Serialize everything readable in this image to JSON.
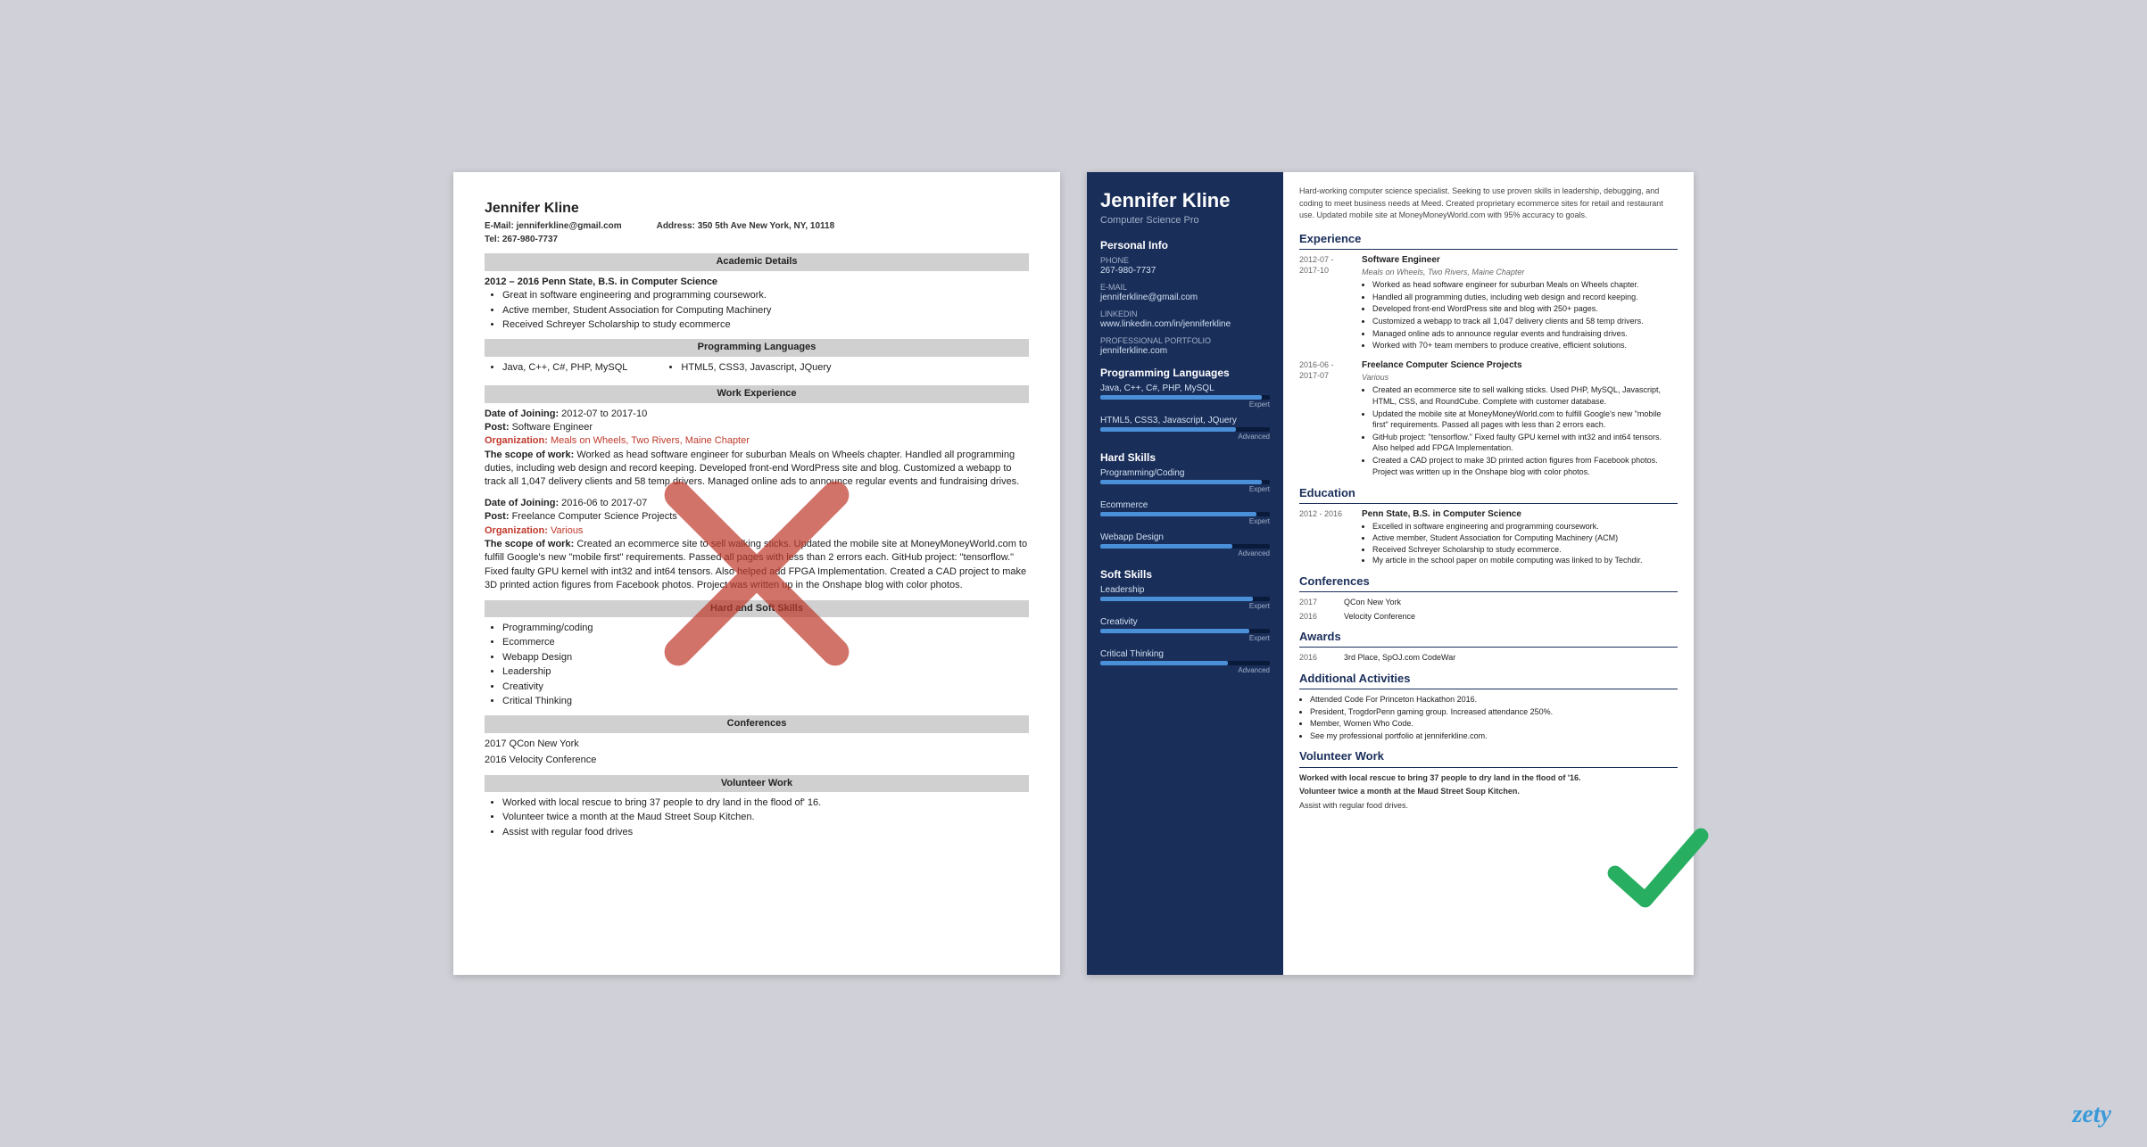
{
  "left_resume": {
    "name": "Jennifer Kline",
    "email_label": "E-Mail:",
    "email": "jenniferkline@gmail.com",
    "address_label": "Address:",
    "address": "350 5th Ave New York, NY, 10118",
    "tel_label": "Tel:",
    "tel": "267-980-7737",
    "sections": {
      "academic": {
        "title": "Academic Details",
        "edu": "2012 – 2016 Penn State, B.S. in Computer Science",
        "bullets": [
          "Great in software engineering and programming coursework.",
          "Active member, Student Association for Computing Machinery",
          "Received Schreyer Scholarship to study ecommerce"
        ]
      },
      "programming": {
        "title": "Programming Languages",
        "col1": "Java, C++, C#, PHP, MySQL",
        "col2": "HTML5, CSS3, Javascript, JQuery"
      },
      "work": {
        "title": "Work Experience",
        "jobs": [
          {
            "date_of_joining_label": "Date of Joining:",
            "date_of_joining": "2012-07 to 2017-10",
            "post_label": "Post:",
            "post": "Software Engineer",
            "org_label": "Organization:",
            "org": "Meals on Wheels, Two Rivers, Maine Chapter",
            "scope_label": "The scope of work:",
            "scope": "Worked as head software engineer for suburban Meals on Wheels chapter. Handled all programming duties, including web design and record keeping. Developed front-end WordPress site and blog. Customized a webapp to track all 1,047 delivery clients and 58 temp drivers. Managed online ads to announce regular events and fundraising drives."
          },
          {
            "date_of_joining_label": "Date of Joining:",
            "date_of_joining": "2016-06 to 2017-07",
            "post_label": "Post:",
            "post": "Freelance Computer Science Projects",
            "org_label": "Organization:",
            "org": "Various",
            "scope_label": "The scope of work:",
            "scope": "Created an ecommerce site to sell walking sticks. Updated the mobile site at MoneyMoneyWorld.com to fulfill Google's new \"mobile first\" requirements. Passed all pages with less than 2 errors each. GitHub project: \"tensorflow.\" Fixed faulty GPU kernel with int32 and int64 tensors. Also helped add FPGA Implementation. Created a CAD project to make 3D printed action figures from Facebook photos. Project was written up in the Onshape blog with color photos."
          }
        ]
      },
      "skills": {
        "title": "Hard and Soft Skills",
        "items": [
          "Programming/coding",
          "Ecommerce",
          "Webapp Design",
          "Leadership",
          "Creativity",
          "Critical Thinking"
        ]
      },
      "conferences": {
        "title": "Conferences",
        "items": [
          "2017 QCon New York",
          "2016 Velocity Conference"
        ]
      },
      "volunteer": {
        "title": "Volunteer Work",
        "bullets": [
          "Worked with local rescue to bring 37 people to dry land in the flood of' 16.",
          "Volunteer twice a month at the Maud Street Soup Kitchen.",
          "Assist with regular food drives"
        ]
      }
    }
  },
  "right_resume": {
    "sidebar": {
      "name": "Jennifer Kline",
      "title": "Computer Science Pro",
      "sections": {
        "personal_info": {
          "title": "Personal Info",
          "phone_label": "Phone",
          "phone": "267-980-7737",
          "email_label": "E-mail",
          "email": "jenniferkline@gmail.com",
          "linkedin_label": "LinkedIn",
          "linkedin": "www.linkedin.com/in/jenniferkline",
          "portfolio_label": "Professional Portfolio",
          "portfolio": "jenniferkline.com"
        },
        "programming": {
          "title": "Programming Languages",
          "skills": [
            {
              "name": "Java, C++, C#, PHP, MySQL",
              "level": "Expert",
              "pct": 95
            },
            {
              "name": "HTML5, CSS3, Javascript, JQuery",
              "level": "Advanced",
              "pct": 80
            }
          ]
        },
        "hard_skills": {
          "title": "Hard Skills",
          "skills": [
            {
              "name": "Programming/Coding",
              "level": "Expert",
              "pct": 95
            },
            {
              "name": "Ecommerce",
              "level": "Expert",
              "pct": 92
            },
            {
              "name": "Webapp Design",
              "level": "Advanced",
              "pct": 78
            }
          ]
        },
        "soft_skills": {
          "title": "Soft Skills",
          "skills": [
            {
              "name": "Leadership",
              "level": "Expert",
              "pct": 90
            },
            {
              "name": "Creativity",
              "level": "Expert",
              "pct": 88
            },
            {
              "name": "Critical Thinking",
              "level": "Advanced",
              "pct": 75
            }
          ]
        }
      }
    },
    "main": {
      "summary": "Hard-working computer science specialist. Seeking to use proven skills in leadership, debugging, and coding to meet business needs at Meed. Created proprietary ecommerce sites for retail and restaurant use. Updated mobile site at MoneyMoneyWorld.com with 95% accuracy to goals.",
      "experience": {
        "title": "Experience",
        "jobs": [
          {
            "dates": "2012-07 - 2017-10",
            "title": "Software Engineer",
            "org": "Meals on Wheels, Two Rivers, Maine Chapter",
            "bullets": [
              "Worked as head software engineer for suburban Meals on Wheels chapter.",
              "Handled all programming duties, including web design and record keeping.",
              "Developed front-end WordPress site and blog with 250+ pages.",
              "Customized a webapp to track all 1,047 delivery clients and 58 temp drivers.",
              "Managed online ads to announce regular events and fundraising drives.",
              "Worked with 70+ team members to produce creative, efficient solutions."
            ]
          },
          {
            "dates": "2016-06 - 2017-07",
            "title": "Freelance Computer Science Projects",
            "org": "Various",
            "bullets": [
              "Created an ecommerce site to sell walking sticks. Used PHP, MySQL, Javascript, HTML, CSS, and RoundCube. Complete with customer database.",
              "Updated the mobile site at MoneyMoneyWorld.com to fulfill Google's new \"mobile first\" requirements. Passed all pages with less than 2 errors each.",
              "GitHub project: \"tensorflow.\" Fixed faulty GPU kernel with int32 and int64 tensors. Also helped add FPGA Implementation.",
              "Created a CAD project to make 3D printed action figures from Facebook photos. Project was written up in the Onshape blog with color photos."
            ]
          }
        ]
      },
      "education": {
        "title": "Education",
        "items": [
          {
            "dates": "2012 - 2016",
            "school": "Penn State, B.S. in Computer Science",
            "bullets": [
              "Excelled in software engineering and programming coursework.",
              "Active member, Student Association for Computing Machinery (ACM)",
              "Received Schreyer Scholarship to study ecommerce.",
              "My article in the school paper on mobile computing was linked to by Techdir."
            ]
          }
        ]
      },
      "conferences": {
        "title": "Conferences",
        "items": [
          {
            "year": "2017",
            "name": "QCon New York"
          },
          {
            "year": "2016",
            "name": "Velocity Conference"
          }
        ]
      },
      "awards": {
        "title": "Awards",
        "items": [
          {
            "year": "2016",
            "name": "3rd Place, SpOJ.com CodeWar"
          }
        ]
      },
      "additional": {
        "title": "Additional Activities",
        "bullets": [
          "Attended Code For Princeton Hackathon 2016.",
          "President, TrogdorPenn gaming group. Increased attendance 250%.",
          "Member, Women Who Code.",
          "See my professional portfolio at jenniferkline.com."
        ]
      },
      "volunteer": {
        "title": "Volunteer Work",
        "items": [
          "Worked with local rescue to bring 37 people to dry land in the flood of '16.",
          "Volunteer twice a month at the Maud Street Soup Kitchen.",
          "Assist with regular food drives."
        ]
      }
    }
  },
  "branding": {
    "zety": "zety"
  }
}
